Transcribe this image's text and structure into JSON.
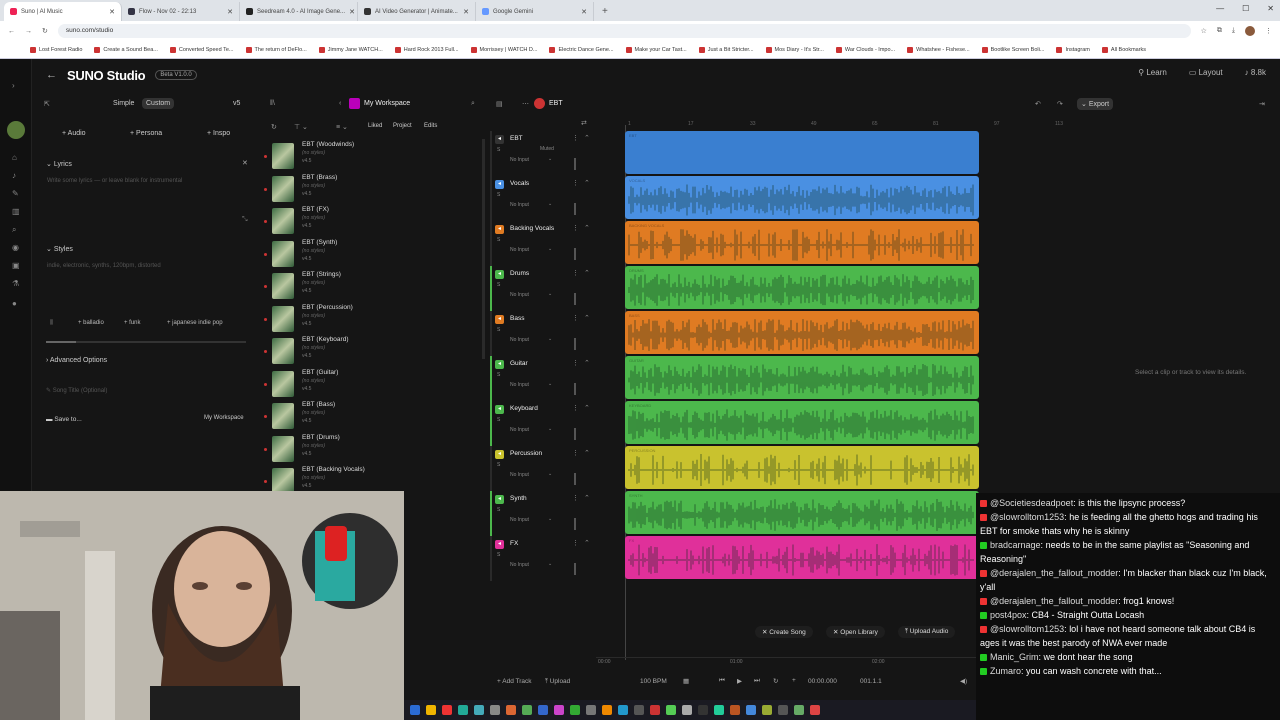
{
  "browser": {
    "tabs": [
      "Suno | AI Music",
      "Flow - Nov 02 - 22:13",
      "Seedream 4.0 - AI Image Gene...",
      "AI Video Generator | Animate...",
      "Google Gemini"
    ],
    "url": "suno.com/studio",
    "bookmarks": [
      "Lost Forest Radio",
      "Create a Sound Bea...",
      "Converted Speed Te...",
      "The return of DeFlo...",
      "Jimmy Jane WATCH...",
      "Hard Rock 2013 Full...",
      "Morrissey | WATCH D...",
      "Electric Dance Gene...",
      "Make your Car Tast...",
      "Just a Bit Stricter...",
      "Mos Diary - It's Str...",
      "War Clouds - Impo...",
      "Whatshee - Fishese...",
      "Bootlike Screen Boli...",
      "Instagram",
      "All Bookmarks"
    ]
  },
  "app": {
    "logo": "SUNO Studio",
    "beta": "Beta V1.0.0",
    "learn": "Learn",
    "layout": "Layout",
    "credits": "8.8k",
    "workspace": "My Workspace",
    "project": "EBT",
    "export": "Export"
  },
  "create": {
    "mode_simple": "Simple",
    "mode_custom": "Custom",
    "version": "v5",
    "add_audio": "Audio",
    "add_persona": "Persona",
    "add_inspo": "Inspo",
    "lyrics_label": "Lyrics",
    "lyrics_placeholder": "Write some lyrics — or leave blank for instrumental",
    "styles_label": "Styles",
    "styles_placeholder": "indie, electronic, synths, 120bpm, distorted",
    "chips": [
      "balladio",
      "funk",
      "japanese indie pop"
    ],
    "advanced": "Advanced Options",
    "song_title_placeholder": "Song Title (Optional)",
    "save_to": "Save to...",
    "save_target": "My Workspace"
  },
  "library": {
    "filters": [
      "Liked",
      "Project",
      "Edits"
    ],
    "songs": [
      {
        "title": "EBT (Woodwinds)",
        "style": "(no styles)",
        "ver": "v4.5"
      },
      {
        "title": "EBT (Brass)",
        "style": "(no styles)",
        "ver": "v4.5"
      },
      {
        "title": "EBT (FX)",
        "style": "(no styles)",
        "ver": "v4.5"
      },
      {
        "title": "EBT (Synth)",
        "style": "(no styles)",
        "ver": "v4.5"
      },
      {
        "title": "EBT (Strings)",
        "style": "(no styles)",
        "ver": "v4.5"
      },
      {
        "title": "EBT (Percussion)",
        "style": "(no styles)",
        "ver": "v4.5"
      },
      {
        "title": "EBT (Keyboard)",
        "style": "(no styles)",
        "ver": "v4.5"
      },
      {
        "title": "EBT (Guitar)",
        "style": "(no styles)",
        "ver": "v4.5"
      },
      {
        "title": "EBT (Bass)",
        "style": "(no styles)",
        "ver": "v4.5"
      },
      {
        "title": "EBT (Drums)",
        "style": "(no styles)",
        "ver": "v4.5"
      },
      {
        "title": "EBT (Backing Vocals)",
        "style": "(no styles)",
        "ver": "v4.5"
      }
    ]
  },
  "tracks": [
    {
      "name": "EBT",
      "input": "No Input",
      "muted": "Muted",
      "color": "#3a7fd0",
      "clip": "EBT"
    },
    {
      "name": "Vocals",
      "input": "No Input",
      "color": "#4a90e2",
      "clip": "VOCALS"
    },
    {
      "name": "Backing Vocals",
      "input": "No Input",
      "color": "#e07b22",
      "clip": "BACKING VOCALS"
    },
    {
      "name": "Drums",
      "input": "No Input",
      "color": "#4cb84c",
      "clip": "DRUMS"
    },
    {
      "name": "Bass",
      "input": "No Input",
      "color": "#e07b22",
      "clip": "BASS"
    },
    {
      "name": "Guitar",
      "input": "No Input",
      "color": "#4cb84c",
      "clip": "GUITAR"
    },
    {
      "name": "Keyboard",
      "input": "No Input",
      "color": "#4cb84c",
      "clip": "KEYBOARD"
    },
    {
      "name": "Percussion",
      "input": "No Input",
      "color": "#c9c22e",
      "clip": "PERCUSSION"
    },
    {
      "name": "Synth",
      "input": "No Input",
      "color": "#4cb84c",
      "clip": "SYNTH"
    },
    {
      "name": "FX",
      "input": "No Input",
      "color": "#e0309a",
      "clip": "FX"
    }
  ],
  "ruler": [
    "1",
    "17",
    "33",
    "49",
    "65",
    "81",
    "97",
    "113"
  ],
  "detail_hint": "Select a clip or track to view its details.",
  "bottom_actions": [
    "Create Song",
    "Open Library",
    "Upload Audio"
  ],
  "timeline": {
    "t0": "00:00",
    "t1": "01:00",
    "t2": "02:00"
  },
  "transport": {
    "add_track": "Add Track",
    "upload": "Upload",
    "bpm": "100 BPM",
    "time": "00:00.000",
    "bar": "001.1.1"
  },
  "chat": [
    {
      "user": "@Societiesdeadpoet",
      "text": "is this the lipsync process?",
      "badge": "#e33"
    },
    {
      "user": "@slowrolltom1253",
      "text": "he is feeding all the ghetto hogs and trading his EBT for smoke thats why he is skinny",
      "badge": "#e33"
    },
    {
      "user": "bradcarnage",
      "text": "needs to be in the same playlist as \"Seasoning and Reasoning\"",
      "badge": "#2c2"
    },
    {
      "user": "@derajalen_the_fallout_modder",
      "text": "I'm blacker than black cuz I'm black, y'all",
      "badge": "#e33"
    },
    {
      "user": "@derajalen_the_fallout_modder",
      "text": "frog1 knows!",
      "badge": "#e33"
    },
    {
      "user": "post4pox",
      "text": "CB4 - Straight Outta Locash",
      "badge": "#2c2"
    },
    {
      "user": "@slowrolltom1253",
      "text": "lol i have not heard someone talk about CB4 is ages it was the best parody of NWA ever made",
      "badge": "#e33"
    },
    {
      "user": "Manic_Grim",
      "text": "we dont hear the song",
      "badge": "#2c2"
    },
    {
      "user": "Zumaro",
      "text": "you can wash concrete with that...",
      "badge": "#2c2"
    }
  ]
}
